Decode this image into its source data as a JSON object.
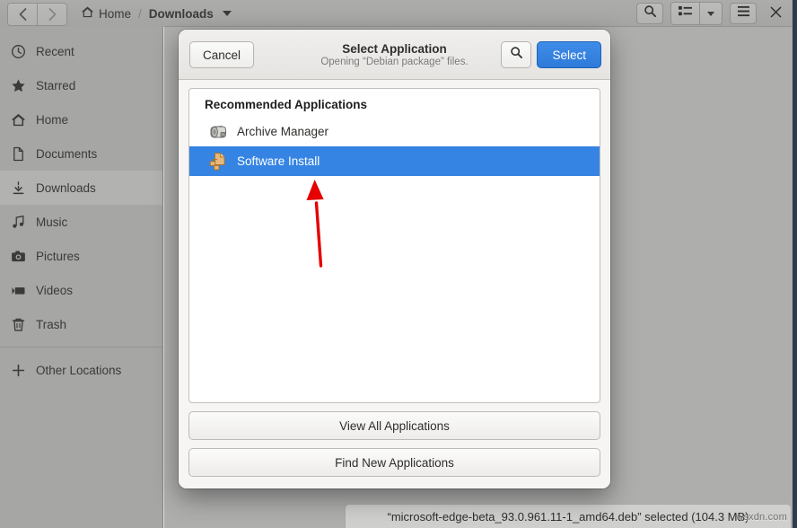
{
  "window": {
    "nav": {
      "back_icon": "chevron-left-icon",
      "forward_icon": "chevron-right-icon"
    },
    "breadcrumb": {
      "home_icon": "home-icon",
      "home_label": "Home",
      "separator": "/",
      "current_label": "Downloads",
      "dropdown_icon": "chevron-down-icon"
    },
    "header_buttons": {
      "search_icon": "search-icon",
      "view_list_icon": "list-view-icon",
      "view_dropdown_icon": "chevron-down-icon",
      "menu_icon": "hamburger-menu-icon",
      "close_icon": "close-icon"
    }
  },
  "sidebar": {
    "items": [
      {
        "label": "Recent",
        "icon": "clock-icon",
        "selected": false
      },
      {
        "label": "Starred",
        "icon": "star-icon",
        "selected": false
      },
      {
        "label": "Home",
        "icon": "home-icon",
        "selected": false
      },
      {
        "label": "Documents",
        "icon": "document-icon",
        "selected": false
      },
      {
        "label": "Downloads",
        "icon": "download-icon",
        "selected": true
      },
      {
        "label": "Music",
        "icon": "music-icon",
        "selected": false
      },
      {
        "label": "Pictures",
        "icon": "camera-icon",
        "selected": false
      },
      {
        "label": "Videos",
        "icon": "video-icon",
        "selected": false
      },
      {
        "label": "Trash",
        "icon": "trash-icon",
        "selected": false
      }
    ],
    "other_locations": {
      "label": "Other Locations",
      "icon": "plus-icon"
    }
  },
  "dialog": {
    "title": "Select Application",
    "subtitle": "Opening “Debian package” files.",
    "cancel_label": "Cancel",
    "search_icon": "search-icon",
    "select_label": "Select",
    "list_header": "Recommended Applications",
    "apps": [
      {
        "name": "Archive Manager",
        "icon": "archive-manager-icon",
        "selected": false
      },
      {
        "name": "Software Install",
        "icon": "software-install-icon",
        "selected": true
      }
    ],
    "view_all_label": "View All Applications",
    "find_new_label": "Find New Applications"
  },
  "statusbar": {
    "text": "“microsoft-edge-beta_93.0.961.11-1_amd64.deb” selected (104.3 MB)"
  },
  "watermark": {
    "text": "wsxdn.com"
  },
  "colors": {
    "selection_blue": "#3584e4",
    "suggested_button": "#3584e4",
    "window_bg": "#f6f5f4",
    "sidebar_bg": "#b3b3b1",
    "annotation_red": "#e60000"
  }
}
